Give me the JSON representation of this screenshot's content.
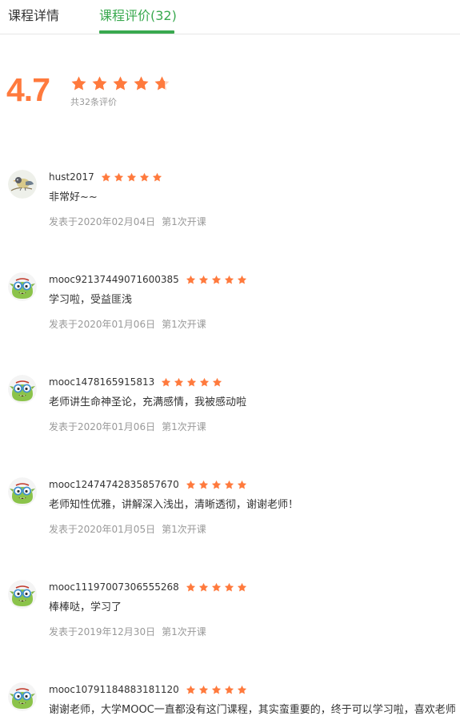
{
  "tabs": [
    {
      "label": "课程详情",
      "active": false
    },
    {
      "label": "课程评价(32)",
      "active": true
    }
  ],
  "colors": {
    "accent": "#39a94f",
    "star": "#ff7a3d",
    "muted": "#999999"
  },
  "summary": {
    "score": "4.7",
    "rating": 4.7,
    "count_text": "共32条评价"
  },
  "reviews": [
    {
      "username": "hust2017",
      "rating": 5,
      "avatar": "bird-avatar",
      "content": "非常好~~",
      "date": "发表于2020年02月04日",
      "session": "第1次开课"
    },
    {
      "username": "mooc92137449071600385",
      "rating": 5,
      "avatar": "default-monster-avatar",
      "content": "学习啦，受益匪浅",
      "date": "发表于2020年01月06日",
      "session": "第1次开课"
    },
    {
      "username": "mooc1478165915813",
      "rating": 5,
      "avatar": "default-monster-avatar",
      "content": "老师讲生命神圣论，充满感情，我被感动啦",
      "date": "发表于2020年01月06日",
      "session": "第1次开课"
    },
    {
      "username": "mooc12474742835857670",
      "rating": 5,
      "avatar": "default-monster-avatar",
      "content": "老师知性优雅，讲解深入浅出，清晰透彻，谢谢老师！",
      "date": "发表于2020年01月05日",
      "session": "第1次开课"
    },
    {
      "username": "mooc11197007306555268",
      "rating": 5,
      "avatar": "default-monster-avatar",
      "content": "棒棒哒，学习了",
      "date": "发表于2019年12月30日",
      "session": "第1次开课"
    },
    {
      "username": "mooc10791184883181120",
      "rating": 5,
      "avatar": "default-monster-avatar",
      "content": "谢谢老师，大学MOOC一直都没有这门课程，其实蛮重要的，终于可以学习啦，喜欢老师",
      "date": "",
      "session": ""
    }
  ]
}
